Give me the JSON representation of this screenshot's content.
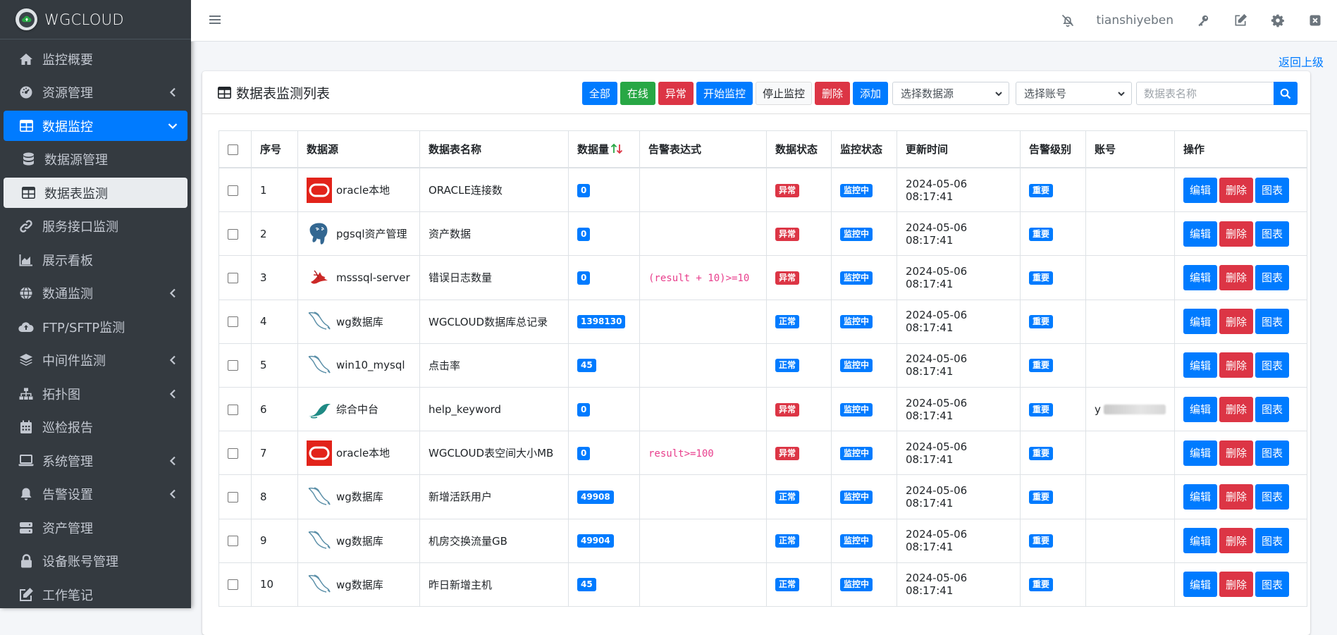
{
  "brand": {
    "name": "WGCLOUD"
  },
  "sidebar": {
    "items": [
      {
        "label": "监控概要",
        "icon": "home-icon",
        "arrow": false
      },
      {
        "label": "资源管理",
        "icon": "dashboard-gauge-icon",
        "arrow": true
      },
      {
        "label": "数据监控",
        "icon": "table-icon",
        "arrow": true,
        "expanded": true
      },
      {
        "label": "数据源管理",
        "icon": "database-icon",
        "arrow": false
      },
      {
        "label": "数据表监测",
        "icon": "table-icon",
        "arrow": false
      },
      {
        "label": "服务接口监测",
        "icon": "link-icon",
        "arrow": false
      },
      {
        "label": "展示看板",
        "icon": "area-chart-icon",
        "arrow": false
      },
      {
        "label": "数通监测",
        "icon": "globe-icon",
        "arrow": true
      },
      {
        "label": "FTP/SFTP监测",
        "icon": "cloud-upload-icon",
        "arrow": false
      },
      {
        "label": "中间件监测",
        "icon": "layers-icon",
        "arrow": true
      },
      {
        "label": "拓扑图",
        "icon": "sitemap-icon",
        "arrow": true
      },
      {
        "label": "巡检报告",
        "icon": "calendar-icon",
        "arrow": false
      },
      {
        "label": "系统管理",
        "icon": "laptop-icon",
        "arrow": true
      },
      {
        "label": "告警设置",
        "icon": "bell-icon",
        "arrow": true
      },
      {
        "label": "资产管理",
        "icon": "server-icon",
        "arrow": false
      },
      {
        "label": "设备账号管理",
        "icon": "lock-icon",
        "arrow": false
      },
      {
        "label": "工作笔记",
        "icon": "edit-icon",
        "arrow": false
      }
    ]
  },
  "topbar": {
    "username": "tianshiyeben"
  },
  "content": {
    "back_link": "返回上级"
  },
  "card": {
    "title": "数据表监测列表",
    "buttons": {
      "all": "全部",
      "online": "在线",
      "abnormal": "异常",
      "start": "开始监控",
      "stop": "停止监控",
      "delete": "删除",
      "add": "添加"
    },
    "select_datasource": "选择数据源",
    "select_account": "选择账号",
    "search_placeholder": "数据表名称"
  },
  "table": {
    "headers": {
      "index": "序号",
      "source": "数据源",
      "name": "数据表名称",
      "count": "数据量",
      "expr": "告警表达式",
      "data_status": "数据状态",
      "monitor_status": "监控状态",
      "update_time": "更新时间",
      "level": "告警级别",
      "account": "账号",
      "ops": "操作"
    },
    "op_labels": {
      "edit": "编辑",
      "delete": "删除",
      "chart": "图表"
    },
    "rows": [
      {
        "index": "1",
        "source": "oracle本地",
        "db": "oracle",
        "name": "ORACLE连接数",
        "count": "0",
        "expr": "",
        "data_status": "异常",
        "data_status_color": "#dc3545",
        "monitor_status": "监控中",
        "update_time": "2024-05-06 08:17:41",
        "level": "重要",
        "account": ""
      },
      {
        "index": "2",
        "source": "pgsql资产管理",
        "db": "postgresql",
        "name": "资产数据",
        "count": "0",
        "expr": "",
        "data_status": "异常",
        "data_status_color": "#dc3545",
        "monitor_status": "监控中",
        "update_time": "2024-05-06 08:17:41",
        "level": "重要",
        "account": ""
      },
      {
        "index": "3",
        "source": "msssql-server",
        "db": "sqlserver",
        "name": "错误日志数量",
        "count": "0",
        "expr": "(result + 10)>=10",
        "data_status": "异常",
        "data_status_color": "#dc3545",
        "monitor_status": "监控中",
        "update_time": "2024-05-06 08:17:41",
        "level": "重要",
        "account": ""
      },
      {
        "index": "4",
        "source": "wg数据库",
        "db": "mysql",
        "name": "WGCLOUD数据库总记录",
        "count": "1398130",
        "expr": "",
        "data_status": "正常",
        "data_status_color": "#007bff",
        "monitor_status": "监控中",
        "update_time": "2024-05-06 08:17:41",
        "level": "重要",
        "account": ""
      },
      {
        "index": "5",
        "source": "win10_mysql",
        "db": "mysql",
        "name": "点击率",
        "count": "45",
        "expr": "",
        "data_status": "正常",
        "data_status_color": "#007bff",
        "monitor_status": "监控中",
        "update_time": "2024-05-06 08:17:41",
        "level": "重要",
        "account": ""
      },
      {
        "index": "6",
        "source": "综合中台",
        "db": "mariadb",
        "name": "help_keyword",
        "count": "0",
        "expr": "",
        "data_status": "异常",
        "data_status_color": "#dc3545",
        "monitor_status": "监控中",
        "update_time": "2024-05-06 08:17:41",
        "level": "重要",
        "account": "y"
      },
      {
        "index": "7",
        "source": "oracle本地",
        "db": "oracle",
        "name": "WGCLOUD表空间大小MB",
        "count": "0",
        "expr": "result>=100",
        "data_status": "异常",
        "data_status_color": "#dc3545",
        "monitor_status": "监控中",
        "update_time": "2024-05-06 08:17:41",
        "level": "重要",
        "account": ""
      },
      {
        "index": "8",
        "source": "wg数据库",
        "db": "mysql",
        "name": "新增活跃用户",
        "count": "49908",
        "expr": "",
        "data_status": "正常",
        "data_status_color": "#007bff",
        "monitor_status": "监控中",
        "update_time": "2024-05-06 08:17:41",
        "level": "重要",
        "account": ""
      },
      {
        "index": "9",
        "source": "wg数据库",
        "db": "mysql",
        "name": "机房交换流量GB",
        "count": "49904",
        "expr": "",
        "data_status": "正常",
        "data_status_color": "#007bff",
        "monitor_status": "监控中",
        "update_time": "2024-05-06 08:17:41",
        "level": "重要",
        "account": ""
      },
      {
        "index": "10",
        "source": "wg数据库",
        "db": "mysql",
        "name": "昨日新增主机",
        "count": "45",
        "expr": "",
        "data_status": "正常",
        "data_status_color": "#007bff",
        "monitor_status": "监控中",
        "update_time": "2024-05-06 08:17:41",
        "level": "重要",
        "account": ""
      }
    ]
  },
  "colors": {
    "primary": "#007bff",
    "success": "#28a745",
    "danger": "#dc3545",
    "sidebar_bg": "#343a40",
    "expression": "#e83e8c",
    "sort_up": "#28a745",
    "sort_down": "#dc3545"
  }
}
